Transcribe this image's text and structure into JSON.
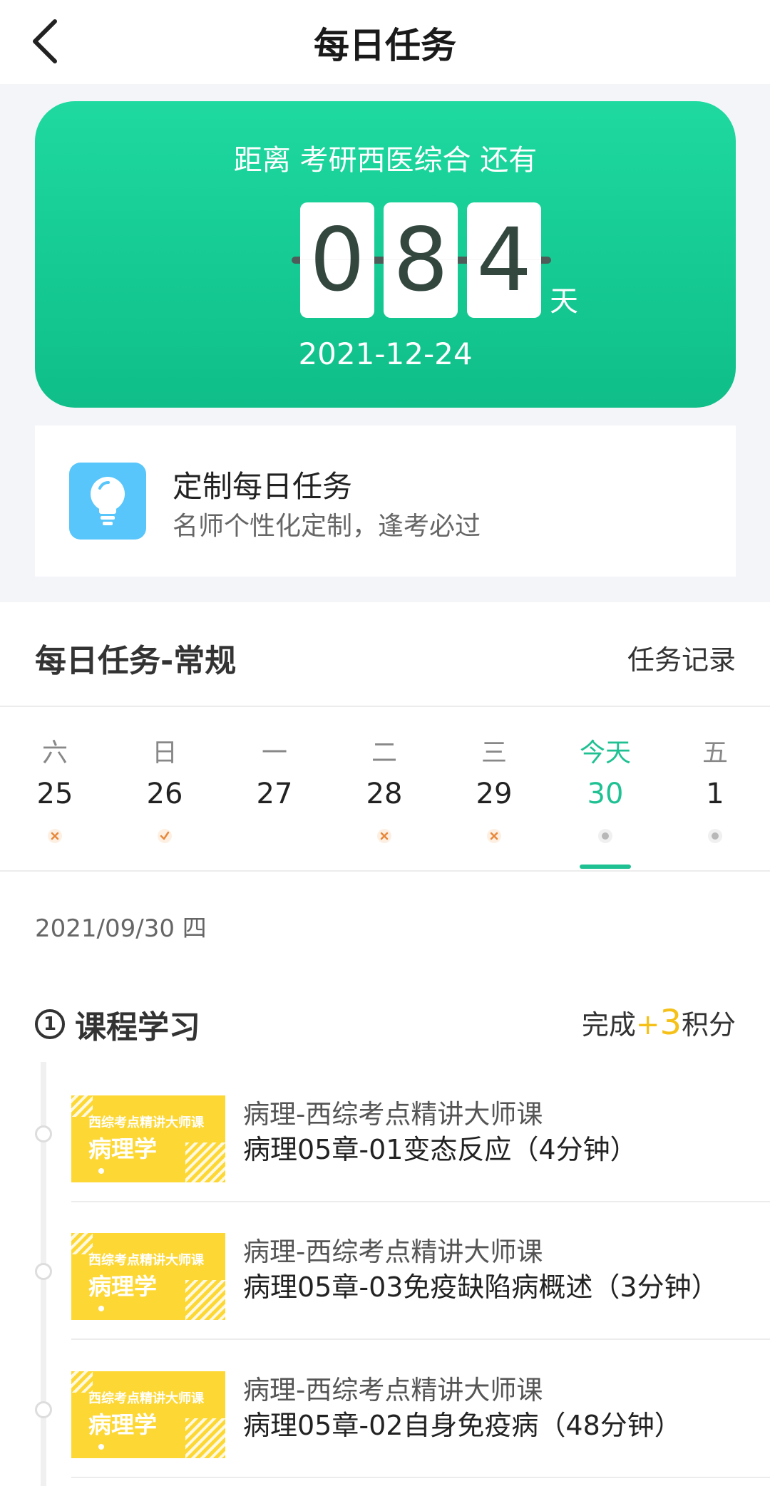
{
  "header": {
    "title": "每日任务",
    "back_icon": "chevron-left-icon"
  },
  "countdown": {
    "label": "距离 考研西医综合 还有",
    "digits": [
      "0",
      "8",
      "4"
    ],
    "unit": "天",
    "date": "2021-12-24",
    "colors": {
      "gradient_top": "#1ed9a0",
      "gradient_bottom": "#0fbe89"
    }
  },
  "custom_task": {
    "icon": "lightbulb-icon",
    "title": "定制每日任务",
    "subtitle": "名师个性化定制，逢考必过",
    "icon_bg": "#58c6fb"
  },
  "section": {
    "title": "每日任务-常规",
    "record_link": "任务记录"
  },
  "week": [
    {
      "weekday": "六",
      "day": "25",
      "status": "missed"
    },
    {
      "weekday": "日",
      "day": "26",
      "status": "done"
    },
    {
      "weekday": "一",
      "day": "27",
      "status": "none"
    },
    {
      "weekday": "二",
      "day": "28",
      "status": "missed"
    },
    {
      "weekday": "三",
      "day": "29",
      "status": "missed"
    },
    {
      "weekday": "今天",
      "day": "30",
      "status": "pending",
      "today": true
    },
    {
      "weekday": "五",
      "day": "1",
      "status": "pending"
    }
  ],
  "selected_date": "2021/09/30 四",
  "course": {
    "index": "1",
    "title": "课程学习",
    "points_prefix": "完成",
    "points_plus": "+",
    "points_value": "3",
    "points_suffix": "积分",
    "accent": "#1fc193",
    "points_color": "#f5c018"
  },
  "lessons": [
    {
      "thumb_sub": "西综考点精讲大师课",
      "thumb_main": "病理学",
      "course": "病理-西综考点精讲大师课",
      "title": "病理05章-01变态反应（4分钟）"
    },
    {
      "thumb_sub": "西综考点精讲大师课",
      "thumb_main": "病理学",
      "course": "病理-西综考点精讲大师课",
      "title": "病理05章-03免疫缺陷病概述（3分钟）"
    },
    {
      "thumb_sub": "西综考点精讲大师课",
      "thumb_main": "病理学",
      "course": "病理-西综考点精讲大师课",
      "title": "病理05章-02自身免疫病（48分钟）"
    }
  ]
}
